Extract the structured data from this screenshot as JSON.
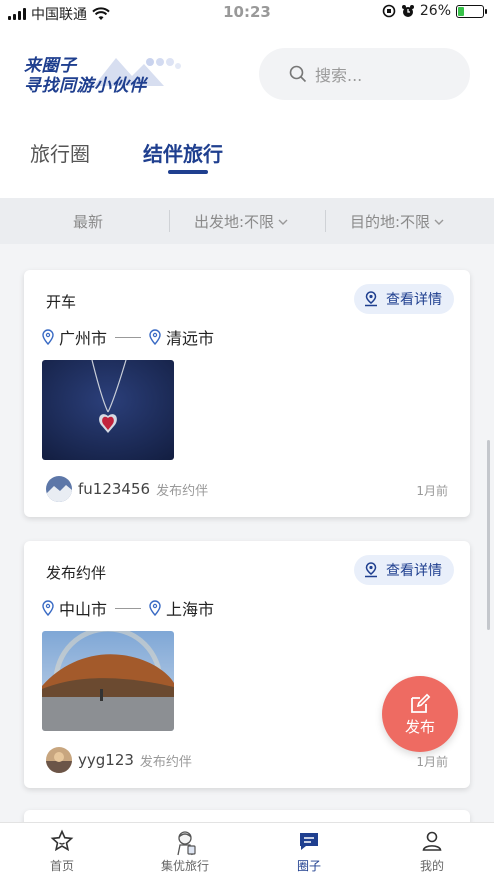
{
  "status_bar": {
    "carrier": "中国联通",
    "time": "10:23",
    "battery": "26%",
    "battery_level": 0.26
  },
  "header": {
    "logo_line1": "来圈子",
    "logo_line2": "寻找同游小伙伴",
    "search_placeholder": "搜索...",
    "tabs": [
      {
        "label": "旅行圈",
        "active": false
      },
      {
        "label": "结伴旅行",
        "active": true
      }
    ]
  },
  "filters": {
    "latest": "最新",
    "departure": "出发地:不限",
    "destination": "目的地:不限"
  },
  "posts": [
    {
      "title": "开车",
      "detail_label": "查看详情",
      "from": "广州市",
      "to": "清远市",
      "image": "necklace-photo",
      "username": "fu123456",
      "action": "发布约伴",
      "time": "1月前"
    },
    {
      "title": "发布约伴",
      "detail_label": "查看详情",
      "from": "中山市",
      "to": "上海市",
      "image": "mountain-photo",
      "username": "yyg123",
      "action": "发布约伴",
      "time": "1月前"
    }
  ],
  "fab": {
    "label": "发布",
    "color": "#ee6b62"
  },
  "bottom_nav": [
    {
      "label": "首页",
      "icon": "star-icon",
      "active": false
    },
    {
      "label": "集优旅行",
      "icon": "traveler-icon",
      "active": false
    },
    {
      "label": "圈子",
      "icon": "chat-icon",
      "active": true
    },
    {
      "label": "我的",
      "icon": "user-icon",
      "active": false
    }
  ],
  "colors": {
    "brand": "#1f3f8f",
    "accent": "#ee6b62"
  }
}
